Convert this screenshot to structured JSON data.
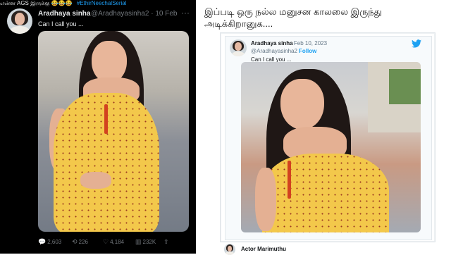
{
  "left_tweet": {
    "top_line": "என்ன AGS இருக்கு 😂😂😂",
    "hashtag": "#EthirNeechalSerial",
    "name": "Aradhaya sinha",
    "handle": "@Aradhayasinha2 · 10 Feb",
    "more": "···",
    "text": "Can I call you ...",
    "stats": {
      "replies": "2,603",
      "retweets": "226",
      "likes": "4,184",
      "views": "232K"
    }
  },
  "caption": "இப்படி ஒரு நல்ல மனுசன காலலை இருந்து அடிக்கிறானுக....",
  "right_tweet": {
    "name": "Aradhaya sinha",
    "date": "· Feb 10, 2023",
    "handle": "@Aradhayasinha2 ·",
    "follow": "Follow",
    "text": "Can I call you ..."
  },
  "bottom_author": "Actor Marimuthu",
  "colors": {
    "dark_bg": "#000000",
    "twitter_blue": "#1da1f2",
    "dress_yellow": "#f3c84b"
  }
}
